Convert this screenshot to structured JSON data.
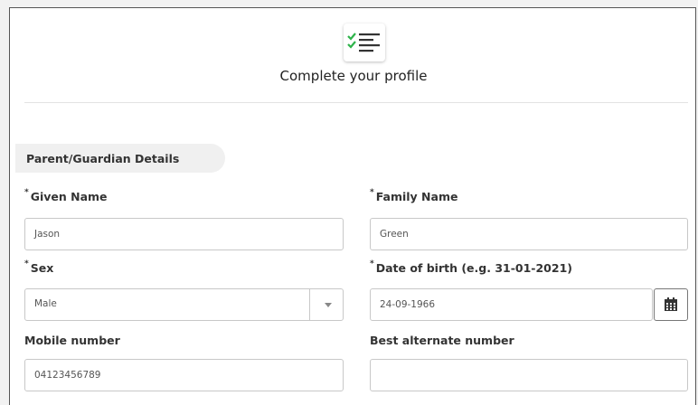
{
  "header": {
    "title": "Complete your profile",
    "icon": "checklist-icon"
  },
  "section": {
    "title": "Parent/Guardian Details"
  },
  "form": {
    "given_name": {
      "required_mark": "*",
      "label": "Given Name",
      "value": "Jason"
    },
    "family_name": {
      "required_mark": "*",
      "label": "Family Name",
      "value": "Green"
    },
    "sex": {
      "required_mark": "*",
      "label": "Sex",
      "value": "Male"
    },
    "dob": {
      "required_mark": "*",
      "label": "Date of birth (e.g. 31-01-2021)",
      "value": "24-09-1966"
    },
    "mobile": {
      "label": "Mobile number",
      "value": "04123456789"
    },
    "alternate": {
      "label": "Best alternate number",
      "value": ""
    }
  },
  "colors": {
    "check": "#2db34a",
    "lines": "#333333",
    "pill_bg": "#f0f0f0"
  }
}
